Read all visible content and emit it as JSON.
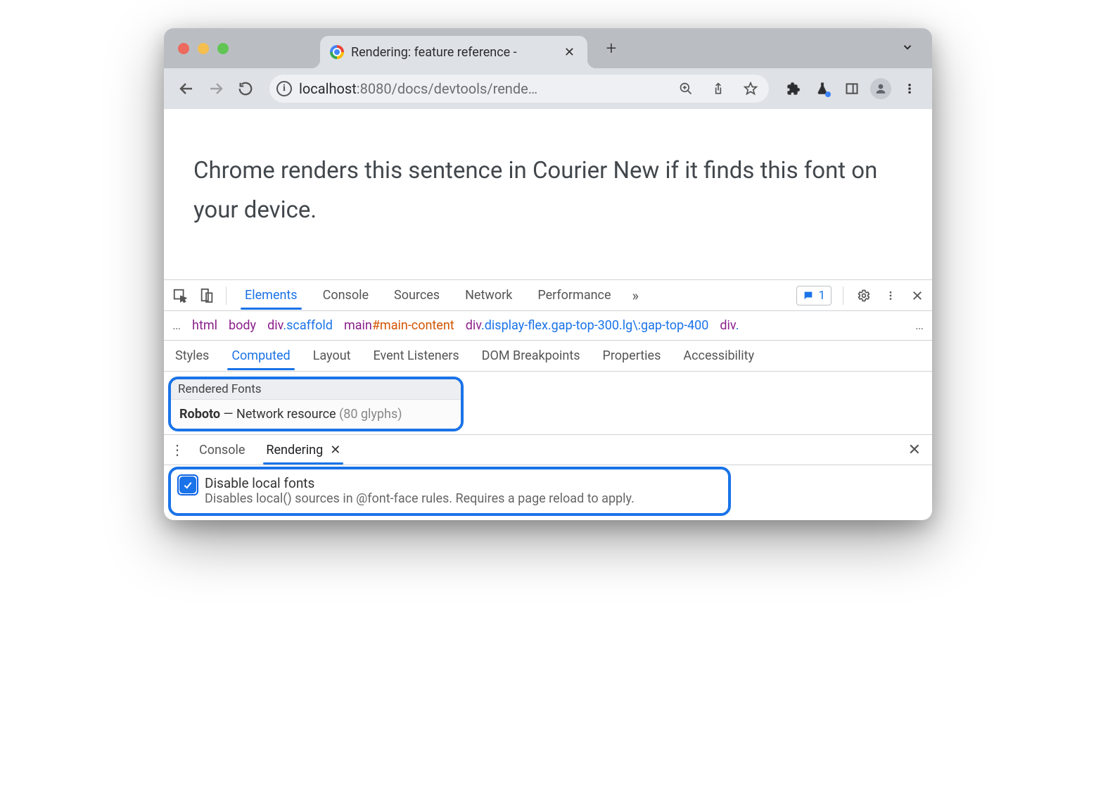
{
  "window": {
    "tab_title": "Rendering: feature reference -",
    "new_tab_glyph": "+"
  },
  "toolbar": {
    "url_host": "localhost",
    "url_rest": ":8080/docs/devtools/rende…"
  },
  "page": {
    "sentence": "Chrome renders this sentence in Courier New if it finds this font on your device."
  },
  "devtools": {
    "tabs": [
      "Elements",
      "Console",
      "Sources",
      "Network",
      "Performance"
    ],
    "active_tab": "Elements",
    "chat_count": "1",
    "breadcrumbs": [
      {
        "tag": "html"
      },
      {
        "tag": "body"
      },
      {
        "tag": "div",
        "cls": ".scaffold"
      },
      {
        "tag": "main",
        "id": "#main-content"
      },
      {
        "tag": "div",
        "cls": ".display-flex.gap-top-300.lg\\:gap-top-400"
      },
      {
        "tag": "div",
        "cls": "."
      }
    ],
    "subtabs": [
      "Styles",
      "Computed",
      "Layout",
      "Event Listeners",
      "DOM Breakpoints",
      "Properties",
      "Accessibility"
    ],
    "active_subtab": "Computed",
    "rendered_fonts": {
      "heading": "Rendered Fonts",
      "font_name": "Roboto",
      "sep": " —  ",
      "source": "Network resource ",
      "glyphs": "(80 glyphs)"
    },
    "drawer": {
      "tabs": [
        "Console",
        "Rendering"
      ],
      "active": "Rendering",
      "option_title": "Disable local fonts",
      "option_desc": "Disables local() sources in @font-face rules. Requires a page reload to apply."
    }
  }
}
